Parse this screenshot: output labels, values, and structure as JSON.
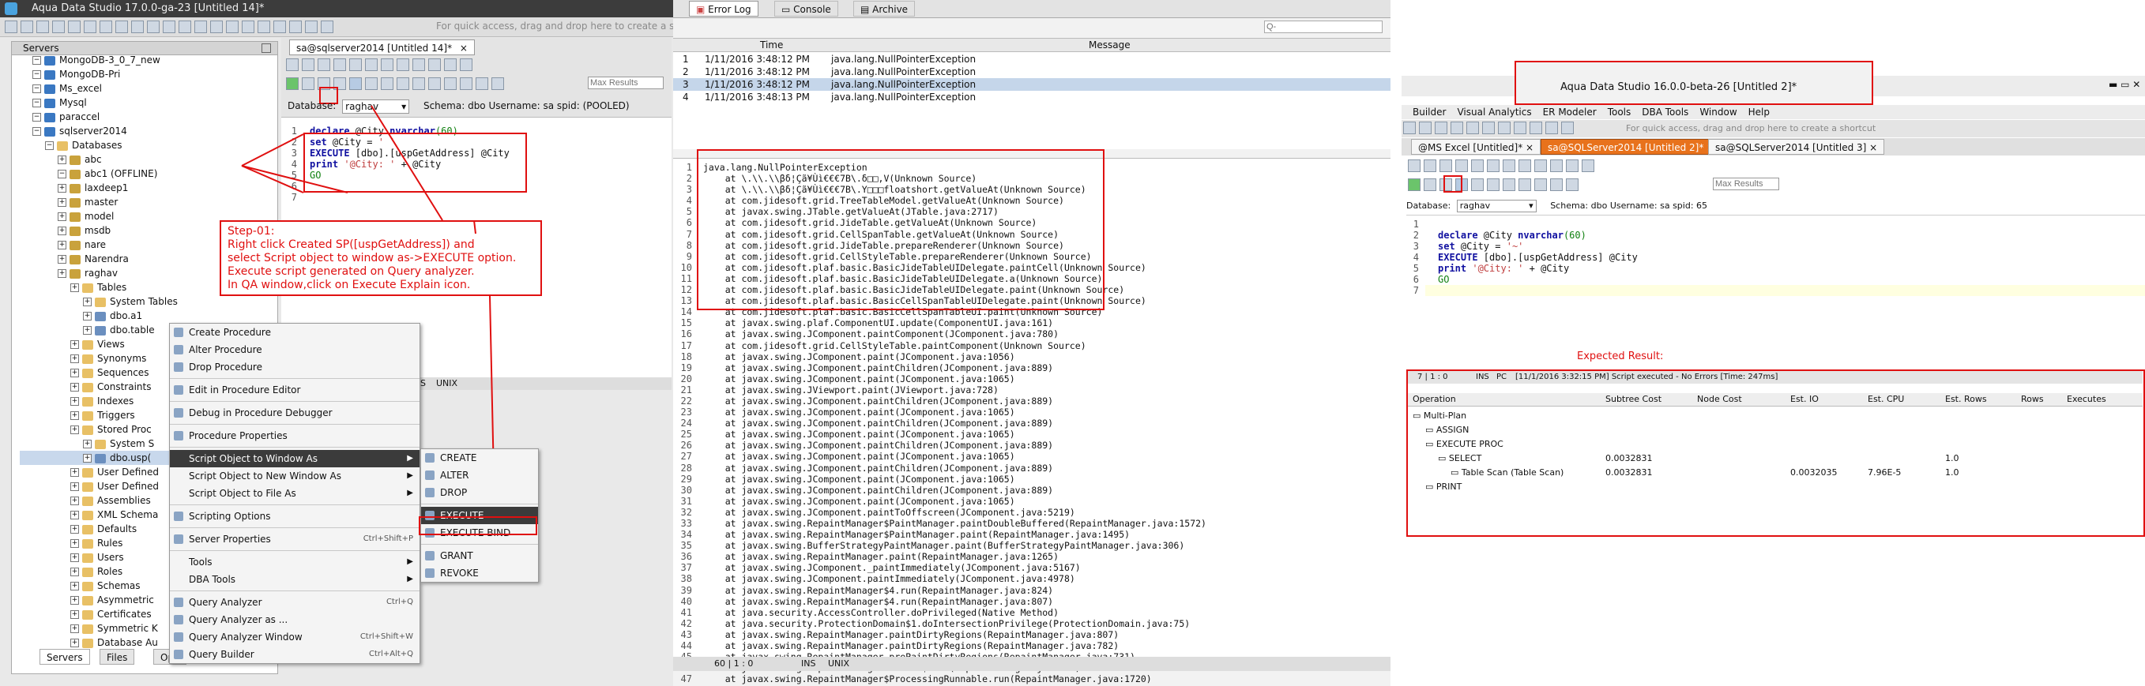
{
  "left": {
    "window_title": "Aqua Data Studio 17.0.0-ga-23 [Untitled 14]*",
    "quick_access_hint": "For quick access, drag and drop here to create a sho",
    "servers_tab": "Servers",
    "tree": [
      {
        "label": "MongoDB-3_0_7_new",
        "indent": 1,
        "icon": "srv"
      },
      {
        "label": "MongoDB-Pri",
        "indent": 1,
        "icon": "srv"
      },
      {
        "label": "Ms_excel",
        "indent": 1,
        "icon": "srv"
      },
      {
        "label": "Mysql",
        "indent": 1,
        "icon": "srv"
      },
      {
        "label": "paraccel",
        "indent": 1,
        "icon": "srv"
      },
      {
        "label": "sqlserver2014",
        "indent": 1,
        "icon": "srv"
      },
      {
        "label": "Databases",
        "indent": 2,
        "icon": "fold"
      },
      {
        "label": "abc",
        "indent": 3,
        "icon": "db"
      },
      {
        "label": "abc1 (OFFLINE)",
        "indent": 3,
        "icon": "db"
      },
      {
        "label": "laxdeep1",
        "indent": 3,
        "icon": "db"
      },
      {
        "label": "master",
        "indent": 3,
        "icon": "db"
      },
      {
        "label": "model",
        "indent": 3,
        "icon": "db"
      },
      {
        "label": "msdb",
        "indent": 3,
        "icon": "db"
      },
      {
        "label": "nare",
        "indent": 3,
        "icon": "db"
      },
      {
        "label": "Narendra",
        "indent": 3,
        "icon": "db"
      },
      {
        "label": "raghav",
        "indent": 3,
        "icon": "db"
      },
      {
        "label": "Tables",
        "indent": 4,
        "icon": "fold"
      },
      {
        "label": "System Tables",
        "indent": 5,
        "icon": "fold"
      },
      {
        "label": "dbo.a1",
        "indent": 5,
        "icon": "tbl"
      },
      {
        "label": "dbo.table",
        "indent": 5,
        "icon": "tbl"
      },
      {
        "label": "Views",
        "indent": 4,
        "icon": "fold"
      },
      {
        "label": "Synonyms",
        "indent": 4,
        "icon": "fold"
      },
      {
        "label": "Sequences",
        "indent": 4,
        "icon": "fold"
      },
      {
        "label": "Constraints",
        "indent": 4,
        "icon": "fold"
      },
      {
        "label": "Indexes",
        "indent": 4,
        "icon": "fold"
      },
      {
        "label": "Triggers",
        "indent": 4,
        "icon": "fold"
      },
      {
        "label": "Stored Proc",
        "indent": 4,
        "icon": "fold"
      },
      {
        "label": "System S",
        "indent": 5,
        "icon": "fold"
      },
      {
        "label": "dbo.usp(",
        "indent": 5,
        "icon": "tbl"
      },
      {
        "label": "User Defined",
        "indent": 4,
        "icon": "fold"
      },
      {
        "label": "User Defined",
        "indent": 4,
        "icon": "fold"
      },
      {
        "label": "Assemblies",
        "indent": 4,
        "icon": "fold"
      },
      {
        "label": "XML Schema",
        "indent": 4,
        "icon": "fold"
      },
      {
        "label": "Defaults",
        "indent": 4,
        "icon": "fold"
      },
      {
        "label": "Rules",
        "indent": 4,
        "icon": "fold"
      },
      {
        "label": "Users",
        "indent": 4,
        "icon": "fold"
      },
      {
        "label": "Roles",
        "indent": 4,
        "icon": "fold"
      },
      {
        "label": "Schemas",
        "indent": 4,
        "icon": "fold"
      },
      {
        "label": "Asymmetric",
        "indent": 4,
        "icon": "fold"
      },
      {
        "label": "Certificates",
        "indent": 4,
        "icon": "fold"
      },
      {
        "label": "Symmetric K",
        "indent": 4,
        "icon": "fold"
      },
      {
        "label": "Database Au",
        "indent": 4,
        "icon": "fold"
      }
    ],
    "bottom_tabs": [
      "Servers",
      "Files",
      "Ope"
    ],
    "editor_tab": "sa@sqlserver2014 [Untitled 14]*",
    "max_results_placeholder": "Max Results",
    "db_label": "Database:",
    "db_value": "raghav",
    "schema_info": "Schema: dbo   Username: sa   spid: (POOLED)",
    "editor_status": [
      "S",
      "UNIX"
    ],
    "code_lines": [
      [
        {
          "t": "declare",
          "c": "kw"
        },
        {
          "t": " @City ",
          "c": ""
        },
        {
          "t": "nvarchar",
          "c": "kw"
        },
        {
          "t": "(60)",
          "c": "num"
        }
      ],
      [
        {
          "t": "set",
          "c": "kw"
        },
        {
          "t": " @City = ",
          "c": ""
        },
        {
          "t": "' '",
          "c": "str"
        }
      ],
      [
        {
          "t": "EXECUTE",
          "c": "kw"
        },
        {
          "t": " [dbo].[uspGetAddress] @City",
          "c": ""
        }
      ],
      [
        {
          "t": "print",
          "c": "kw"
        },
        {
          "t": " ",
          "c": ""
        },
        {
          "t": "'@City: '",
          "c": "str"
        },
        {
          "t": " + @City",
          "c": ""
        }
      ],
      [
        {
          "t": "GO",
          "c": "num"
        }
      ],
      [
        {
          "t": "",
          "c": ""
        }
      ],
      [
        {
          "t": "",
          "c": ""
        }
      ]
    ],
    "step_text": [
      "Step-01:",
      "Right click Created SP([uspGetAddress]) and",
      "select Script object to window as->EXECUTE option.",
      "Execute script generated on Query analyzer.",
      "In QA window,click on Execute Explain icon."
    ],
    "context_menu": [
      {
        "label": "Create Procedure",
        "icon": true
      },
      {
        "label": "Alter Procedure",
        "icon": true
      },
      {
        "label": "Drop Procedure",
        "icon": true
      },
      {
        "sep": true
      },
      {
        "label": "Edit in Procedure Editor",
        "icon": true
      },
      {
        "sep": true
      },
      {
        "label": "Debug in Procedure Debugger",
        "icon": true
      },
      {
        "sep": true
      },
      {
        "label": "Procedure Properties",
        "icon": true
      },
      {
        "sep": true
      },
      {
        "label": "Script Object to Window As",
        "arrow": true,
        "sel": true
      },
      {
        "label": "Script Object to New Window As",
        "arrow": true
      },
      {
        "label": "Script Object to File As",
        "arrow": true
      },
      {
        "sep": true
      },
      {
        "label": "Scripting Options",
        "icon": true
      },
      {
        "sep": true
      },
      {
        "label": "Server Properties",
        "sc": "Ctrl+Shift+P",
        "icon": true
      },
      {
        "sep": true
      },
      {
        "label": "Tools",
        "arrow": true
      },
      {
        "label": "DBA Tools",
        "arrow": true
      },
      {
        "sep": true
      },
      {
        "label": "Query Analyzer",
        "sc": "Ctrl+Q",
        "icon": true
      },
      {
        "label": "Query Analyzer as ...",
        "icon": true
      },
      {
        "label": "Query Analyzer Window",
        "sc": "Ctrl+Shift+W",
        "icon": true
      },
      {
        "label": "Query Builder",
        "sc": "Ctrl+Alt+Q",
        "icon": true
      }
    ],
    "submenu": [
      {
        "label": "CREATE"
      },
      {
        "label": "ALTER"
      },
      {
        "label": "DROP"
      },
      {
        "sep": true
      },
      {
        "label": "EXECUTE",
        "sel": true
      },
      {
        "label": "EXECUTE BIND"
      },
      {
        "sep": true
      },
      {
        "label": "GRANT"
      },
      {
        "label": "REVOKE"
      }
    ]
  },
  "middle": {
    "tabs": [
      "Error Log",
      "Console",
      "Archive"
    ],
    "search_placeholder": "Q-",
    "cols": {
      "time": "Time",
      "message": "Message"
    },
    "rows": [
      {
        "n": "1",
        "time": "1/11/2016 3:48:12 PM",
        "msg": "java.lang.NullPointerException"
      },
      {
        "n": "2",
        "time": "1/11/2016 3:48:12 PM",
        "msg": "java.lang.NullPointerException"
      },
      {
        "n": "3",
        "time": "1/11/2016 3:48:12 PM",
        "msg": "java.lang.NullPointerException"
      },
      {
        "n": "4",
        "time": "1/11/2016 3:48:13 PM",
        "msg": "java.lang.NullPointerException"
      }
    ],
    "stack": [
      "java.lang.NullPointerException",
      "    at \\.\\\\.\\\\βδ¦Çã¥Ùì€€€7B\\.δ□□,V(Unknown Source)",
      "    at \\.\\\\.\\\\βδ¦Çã¥Ùì€€€7B\\.Y□□□floatshort.getValueAt(Unknown Source)",
      "    at com.jidesoft.grid.TreeTableModel.getValueAt(Unknown Source)",
      "    at javax.swing.JTable.getValueAt(JTable.java:2717)",
      "    at com.jidesoft.grid.JideTable.getValueAt(Unknown Source)",
      "    at com.jidesoft.grid.CellSpanTable.getValueAt(Unknown Source)",
      "    at com.jidesoft.grid.JideTable.prepareRenderer(Unknown Source)",
      "    at com.jidesoft.grid.CellStyleTable.prepareRenderer(Unknown Source)",
      "    at com.jidesoft.plaf.basic.BasicJideTableUIDelegate.paintCell(Unknown Source)",
      "    at com.jidesoft.plaf.basic.BasicJideTableUIDelegate.a(Unknown Source)",
      "    at com.jidesoft.plaf.basic.BasicJideTableUIDelegate.paint(Unknown Source)",
      "    at com.jidesoft.plaf.basic.BasicCellSpanTableUIDelegate.paint(Unknown Source)",
      "    at com.jidesoft.plaf.basic.BasicCellSpanTableUI.paint(Unknown Source)",
      "    at javax.swing.plaf.ComponentUI.update(ComponentUI.java:161)",
      "    at javax.swing.JComponent.paintComponent(JComponent.java:780)",
      "    at com.jidesoft.grid.CellStyleTable.paintComponent(Unknown Source)",
      "    at javax.swing.JComponent.paint(JComponent.java:1056)",
      "    at javax.swing.JComponent.paintChildren(JComponent.java:889)",
      "    at javax.swing.JComponent.paint(JComponent.java:1065)",
      "    at javax.swing.JViewport.paint(JViewport.java:728)",
      "    at javax.swing.JComponent.paintChildren(JComponent.java:889)",
      "    at javax.swing.JComponent.paint(JComponent.java:1065)",
      "    at javax.swing.JComponent.paintChildren(JComponent.java:889)",
      "    at javax.swing.JComponent.paint(JComponent.java:1065)",
      "    at javax.swing.JComponent.paintChildren(JComponent.java:889)",
      "    at javax.swing.JComponent.paint(JComponent.java:1065)",
      "    at javax.swing.JComponent.paintChildren(JComponent.java:889)",
      "    at javax.swing.JComponent.paint(JComponent.java:1065)",
      "    at javax.swing.JComponent.paintChildren(JComponent.java:889)",
      "    at javax.swing.JComponent.paint(JComponent.java:1065)",
      "    at javax.swing.JComponent.paintToOffscreen(JComponent.java:5219)",
      "    at javax.swing.RepaintManager$PaintManager.paintDoubleBuffered(RepaintManager.java:1572)",
      "    at javax.swing.RepaintManager$PaintManager.paint(RepaintManager.java:1495)",
      "    at javax.swing.BufferStrategyPaintManager.paint(BufferStrategyPaintManager.java:306)",
      "    at javax.swing.RepaintManager.paint(RepaintManager.java:1265)",
      "    at javax.swing.JComponent._paintImmediately(JComponent.java:5167)",
      "    at javax.swing.JComponent.paintImmediately(JComponent.java:4978)",
      "    at javax.swing.RepaintManager$4.run(RepaintManager.java:824)",
      "    at javax.swing.RepaintManager$4.run(RepaintManager.java:807)",
      "    at java.security.AccessController.doPrivileged(Native Method)",
      "    at java.security.ProtectionDomain$1.doIntersectionPrivilege(ProtectionDomain.java:75)",
      "    at javax.swing.RepaintManager.paintDirtyRegions(RepaintManager.java:807)",
      "    at javax.swing.RepaintManager.paintDirtyRegions(RepaintManager.java:782)",
      "    at javax.swing.RepaintManager.prePaintDirtyRegions(RepaintManager.java:731)",
      "    at javax.swing.RepaintManager.access$1300(RepaintManager.java:64)",
      "    at javax.swing.RepaintManager$ProcessingRunnable.run(RepaintManager.java:1720)"
    ],
    "status": [
      "60 | 1 : 0",
      "INS",
      "UNIX"
    ]
  },
  "right": {
    "window_title": "Aqua Data Studio 16.0.0-beta-26 [Untitled 2]*",
    "menu": [
      "Builder",
      "Visual Analytics",
      "ER Modeler",
      "Tools",
      "DBA Tools",
      "Window",
      "Help"
    ],
    "quick_access_hint": "For quick access, drag and drop here to create a shortcut",
    "tabs": [
      "@MS Excel [Untitled]*",
      "sa@SQLServer2014 [Untitled 2]*",
      "sa@SQLServer2014 [Untitled 3]"
    ],
    "max_results_placeholder": "Max Results",
    "db_label": "Database:",
    "db_value": "raghav",
    "schema_info": "Schema: dbo    Username: sa    spid: 65",
    "code_lines": [
      [
        {
          "t": "declare",
          "c": "kw"
        },
        {
          "t": " @City ",
          "c": ""
        },
        {
          "t": "nvarchar",
          "c": "kw"
        },
        {
          "t": "(60)",
          "c": "num"
        }
      ],
      [
        {
          "t": "set",
          "c": "kw"
        },
        {
          "t": " @City = ",
          "c": ""
        },
        {
          "t": "'~'",
          "c": "str"
        }
      ],
      [
        {
          "t": "EXECUTE",
          "c": "kw"
        },
        {
          "t": " [dbo].[uspGetAddress] @City",
          "c": ""
        }
      ],
      [
        {
          "t": "print",
          "c": "kw"
        },
        {
          "t": " ",
          "c": ""
        },
        {
          "t": "'@City: '",
          "c": "str"
        },
        {
          "t": " + @City",
          "c": ""
        }
      ],
      [
        {
          "t": "GO",
          "c": "num"
        }
      ],
      [
        {
          "t": "",
          "c": ""
        }
      ],
      [
        {
          "t": "",
          "c": ""
        }
      ]
    ],
    "expected_label": "Expected Result:",
    "status": [
      "7 | 1 : 0",
      "INS",
      "PC",
      "[11/1/2016 3:32:15 PM]  Script executed - No Errors  [Time: 247ms]"
    ],
    "plan_cols": [
      "Operation",
      "Subtree Cost",
      "Node Cost",
      "Est. IO",
      "Est. CPU",
      "Est. Rows",
      "Rows",
      "Executes"
    ],
    "plan_rows": [
      {
        "op": "Multi-Plan",
        "indent": 0,
        "subtree": "",
        "node": "",
        "io": "",
        "cpu": "",
        "rows": ""
      },
      {
        "op": "ASSIGN",
        "indent": 1,
        "subtree": "",
        "node": "",
        "io": "",
        "cpu": "",
        "rows": ""
      },
      {
        "op": "EXECUTE PROC",
        "indent": 1,
        "subtree": "",
        "node": "",
        "io": "",
        "cpu": "",
        "rows": ""
      },
      {
        "op": "SELECT",
        "indent": 2,
        "subtree": "0.0032831",
        "node": "",
        "io": "",
        "cpu": "",
        "rows": "1.0"
      },
      {
        "op": "Table Scan (Table Scan)",
        "indent": 3,
        "subtree": "0.0032831",
        "node": "",
        "io": "0.0032035",
        "cpu": "7.96E-5",
        "rows": "1.0"
      },
      {
        "op": "PRINT",
        "indent": 1,
        "subtree": "",
        "node": "",
        "io": "",
        "cpu": "",
        "rows": ""
      }
    ]
  }
}
